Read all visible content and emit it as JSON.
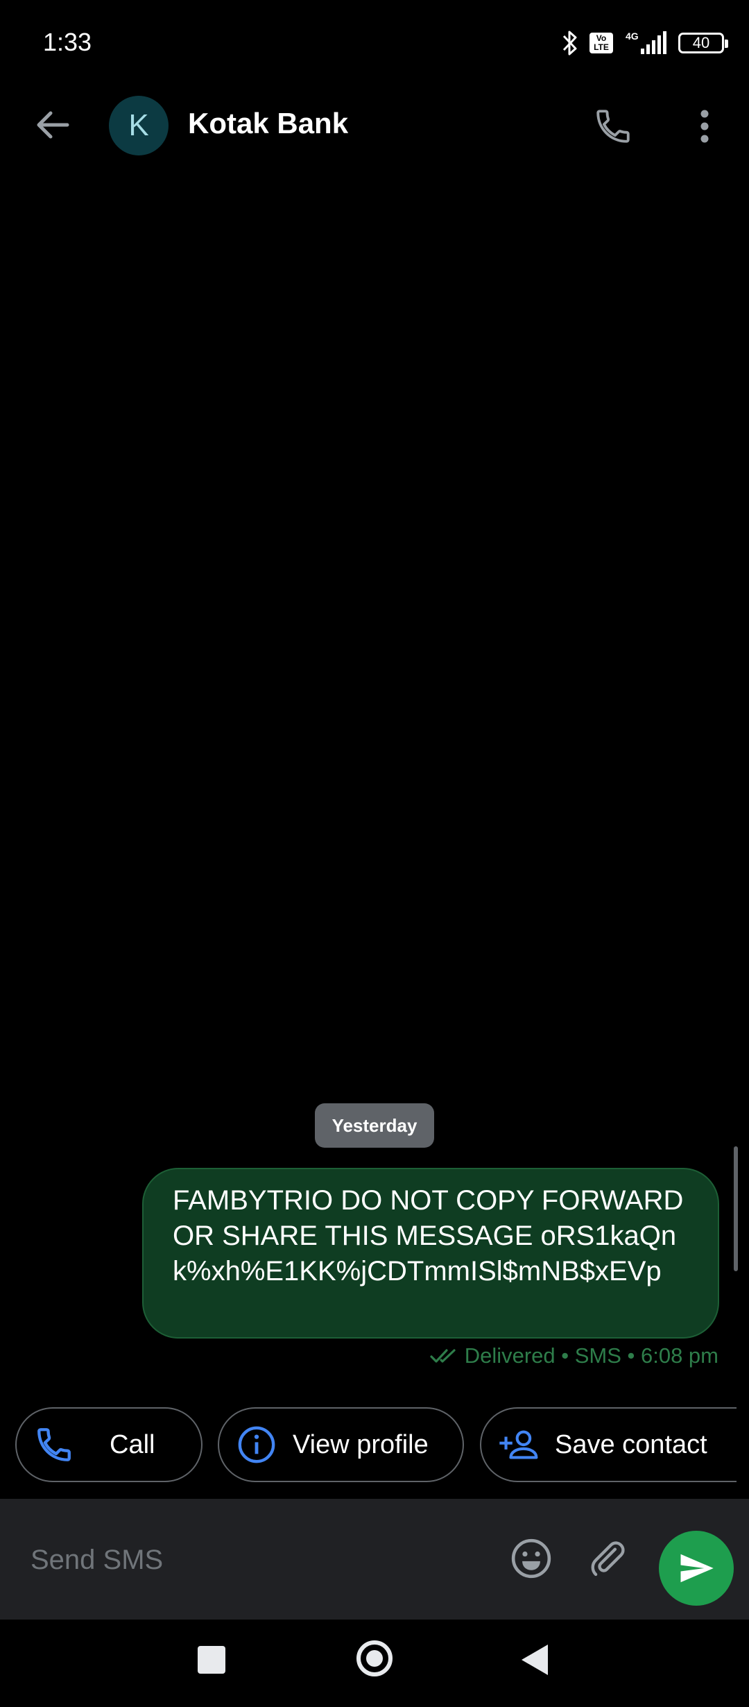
{
  "status_bar": {
    "time": "1:33",
    "volte_label": "Vo LTE",
    "network_label": "4G",
    "battery_level": "40"
  },
  "app_bar": {
    "avatar_initial": "K",
    "contact_name": "Kotak Bank"
  },
  "conversation": {
    "date_divider": "Yesterday",
    "messages": [
      {
        "text": "FAMBYTRIO DO NOT COPY FORWARD OR SHARE THIS MESSAGE oRS1kaQnk%xh%E1KK%jCDTmmISl$mNB$xEVp",
        "status": "Delivered • SMS • 6:08 pm"
      }
    ]
  },
  "suggestions": [
    {
      "label": "Call",
      "icon": "phone-icon"
    },
    {
      "label": "View profile",
      "icon": "info-icon"
    },
    {
      "label": "Save contact",
      "icon": "add-person-icon"
    }
  ],
  "compose": {
    "placeholder": "Send SMS"
  },
  "colors": {
    "accent_blue": "#4285f4",
    "bubble_green": "#0f3d22",
    "send_green": "#1e9e4e",
    "status_green": "#2e7d4a"
  }
}
